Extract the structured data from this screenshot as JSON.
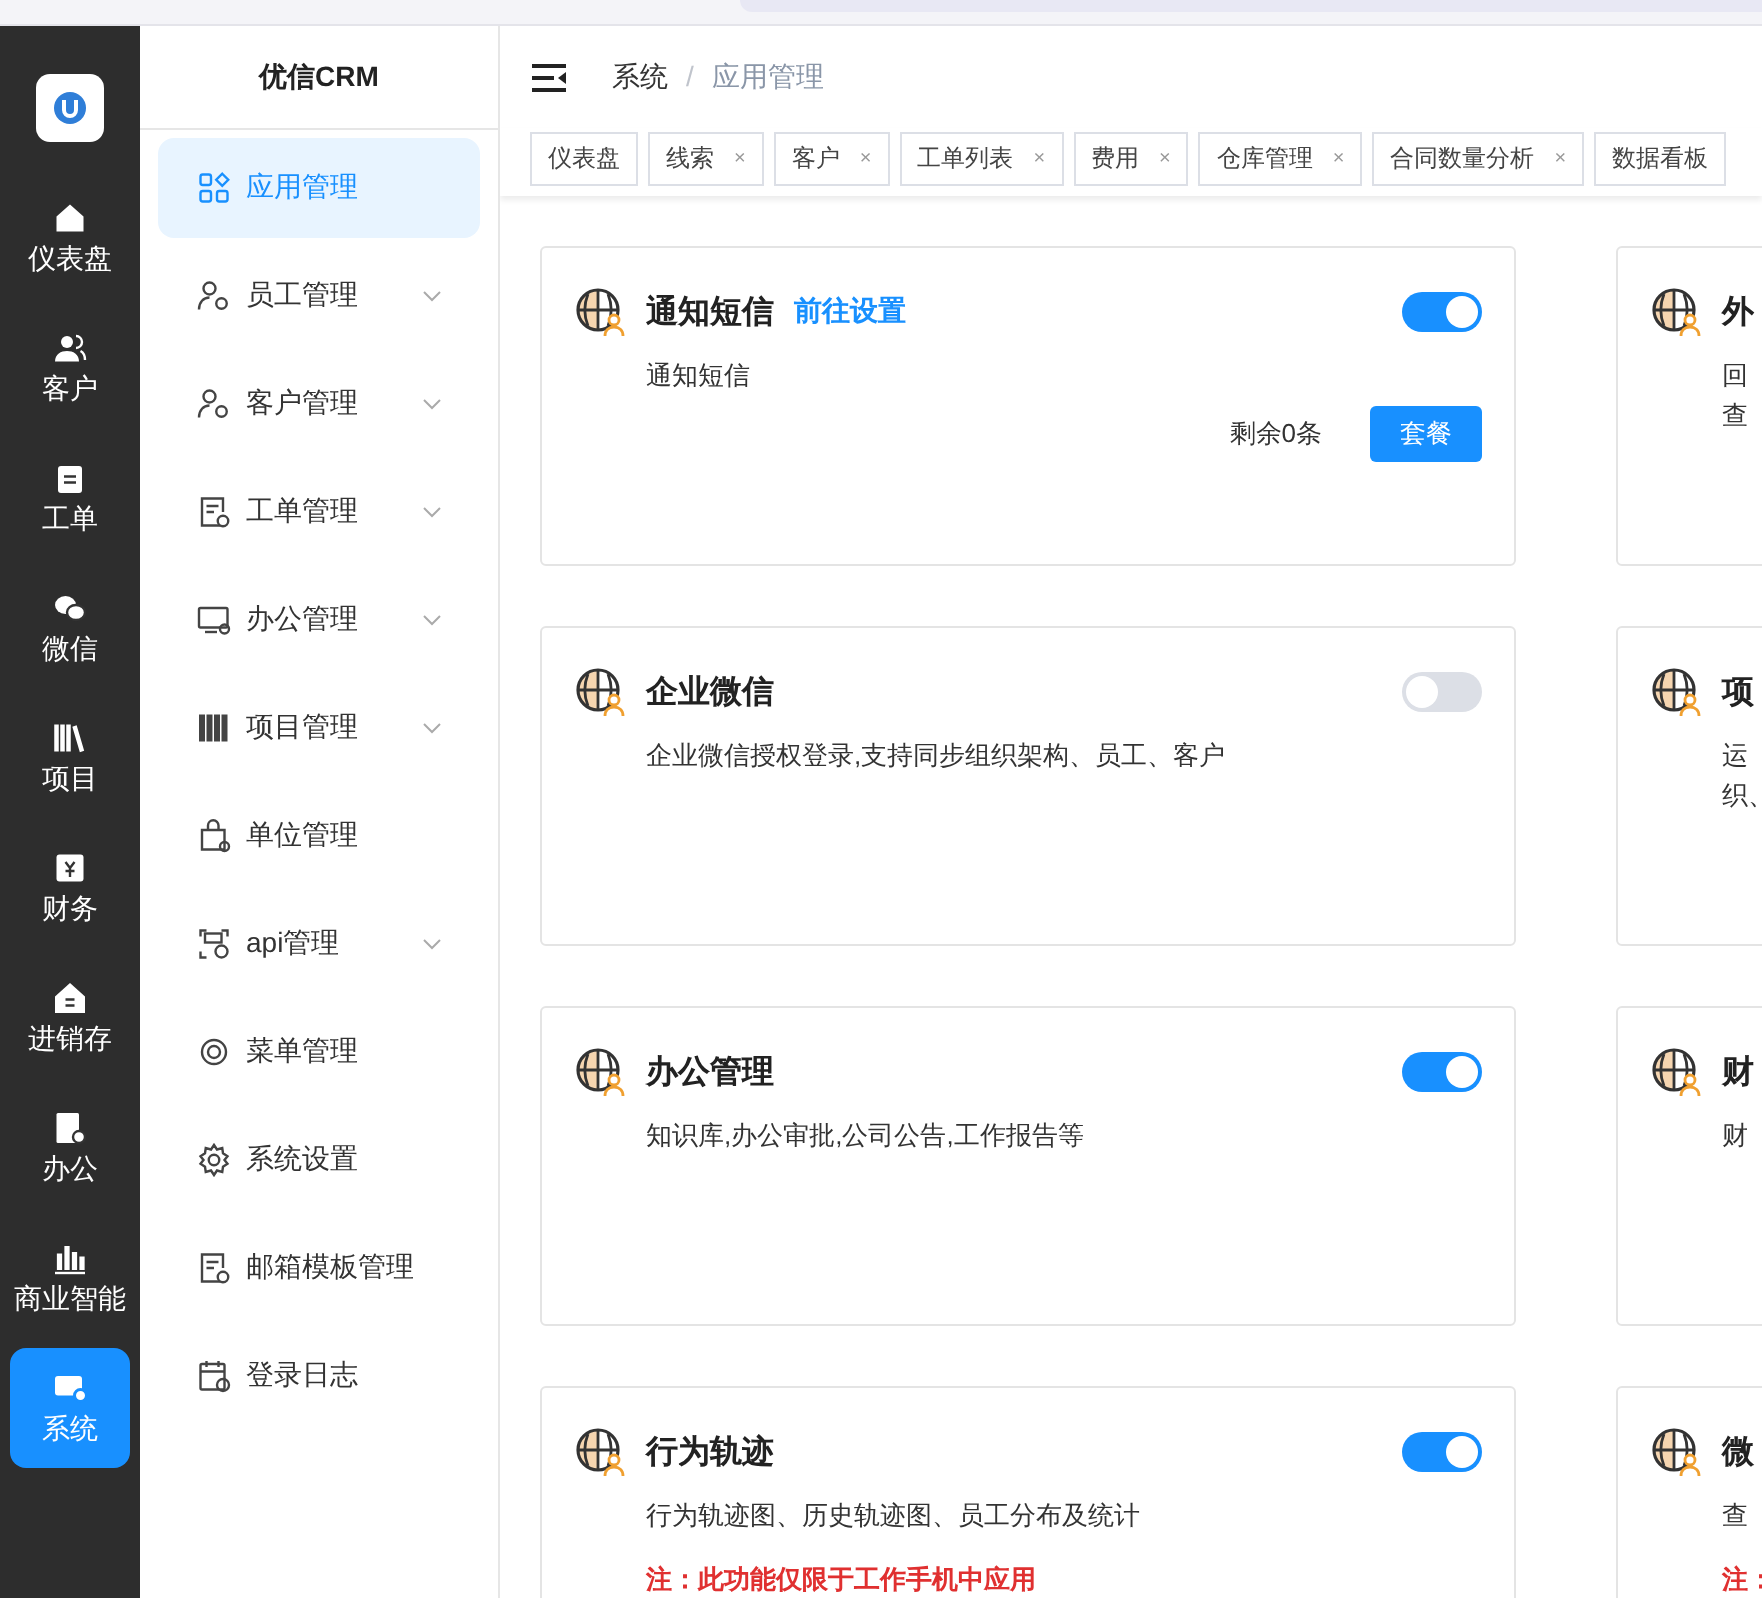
{
  "rail": {
    "items": [
      {
        "label": "仪表盘",
        "selected": false
      },
      {
        "label": "客户",
        "selected": false
      },
      {
        "label": "工单",
        "selected": false
      },
      {
        "label": "微信",
        "selected": false
      },
      {
        "label": "项目",
        "selected": false
      },
      {
        "label": "财务",
        "selected": false
      },
      {
        "label": "进销存",
        "selected": false
      },
      {
        "label": "办公",
        "selected": false
      },
      {
        "label": "商业智能",
        "selected": false
      },
      {
        "label": "系统",
        "selected": true
      }
    ]
  },
  "sidebar": {
    "title": "优信CRM",
    "items": [
      {
        "label": "应用管理",
        "expandable": false,
        "selected": true
      },
      {
        "label": "员工管理",
        "expandable": true,
        "selected": false
      },
      {
        "label": "客户管理",
        "expandable": true,
        "selected": false
      },
      {
        "label": "工单管理",
        "expandable": true,
        "selected": false
      },
      {
        "label": "办公管理",
        "expandable": true,
        "selected": false
      },
      {
        "label": "项目管理",
        "expandable": true,
        "selected": false
      },
      {
        "label": "单位管理",
        "expandable": false,
        "selected": false
      },
      {
        "label": "api管理",
        "expandable": true,
        "selected": false
      },
      {
        "label": "菜单管理",
        "expandable": false,
        "selected": false
      },
      {
        "label": "系统设置",
        "expandable": false,
        "selected": false
      },
      {
        "label": "邮箱模板管理",
        "expandable": false,
        "selected": false
      },
      {
        "label": "登录日志",
        "expandable": false,
        "selected": false
      }
    ]
  },
  "breadcrumb": {
    "items": [
      "系统",
      "应用管理"
    ],
    "separator": "/"
  },
  "tabs": [
    {
      "label": "仪表盘"
    },
    {
      "label": "线索",
      "close": "×"
    },
    {
      "label": "客户",
      "close": "×"
    },
    {
      "label": "工单列表",
      "close": "×"
    },
    {
      "label": "费用",
      "close": "×"
    },
    {
      "label": "仓库管理",
      "close": "×"
    },
    {
      "label": "合同数量分析",
      "close": "×"
    },
    {
      "label": "数据看板"
    }
  ],
  "cards": [
    {
      "title": "通知短信",
      "link": "前往设置",
      "on": true,
      "description": [
        "通知短信"
      ],
      "footer": {
        "text": "剩余0条",
        "button": "套餐"
      }
    },
    {
      "title": "外",
      "description": [
        "回",
        "查"
      ]
    },
    {
      "title": "企业微信",
      "on": false,
      "description": [
        "企业微信授权登录,支持同步组织架构、员工、客户"
      ]
    },
    {
      "title": "项",
      "description": [
        "运",
        "织、"
      ]
    },
    {
      "title": "办公管理",
      "on": true,
      "description": [
        "知识库,办公审批,公司公告,工作报告等"
      ]
    },
    {
      "title": "财",
      "description": [
        "财"
      ]
    },
    {
      "title": "行为轨迹",
      "on": true,
      "description": [
        "行为轨迹图、历史轨迹图、员工分布及统计"
      ],
      "note": "注：此功能仅限于工作手机中应用"
    },
    {
      "title": "微",
      "description": [
        "查"
      ],
      "note": "注："
    }
  ]
}
